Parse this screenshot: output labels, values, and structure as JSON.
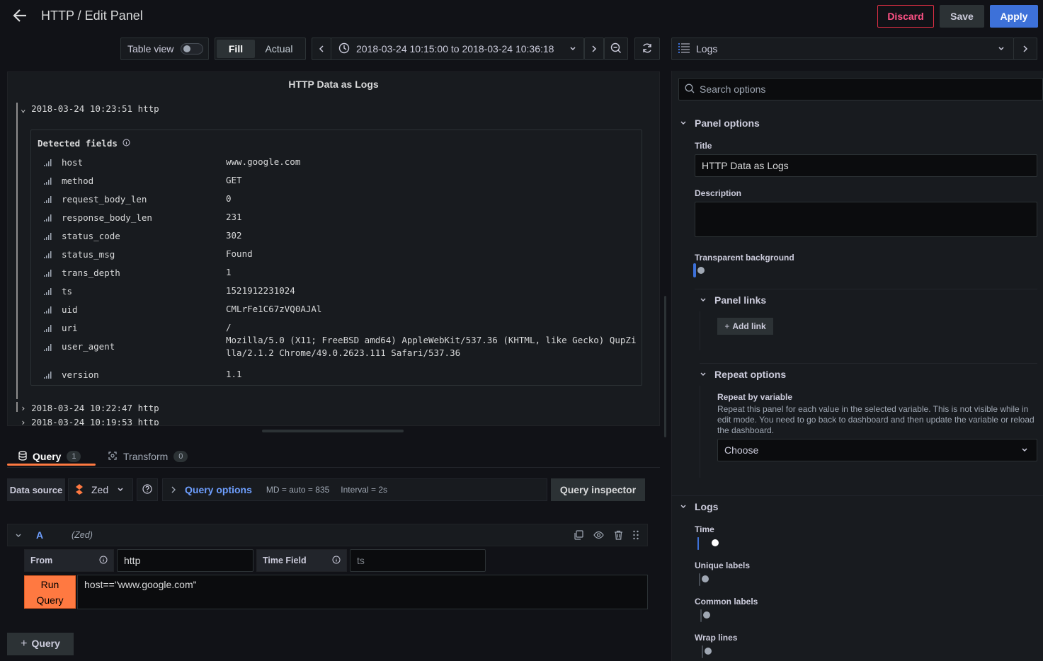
{
  "header": {
    "title": "HTTP / Edit Panel",
    "discard_label": "Discard",
    "save_label": "Save",
    "apply_label": "Apply"
  },
  "toolbar": {
    "table_view_label": "Table view",
    "table_view_on": false,
    "fill_label": "Fill",
    "actual_label": "Actual",
    "time_range": "2018-03-24 10:15:00 to 2018-03-24 10:36:18",
    "visualization": "Logs"
  },
  "panel": {
    "title": "HTTP Data as Logs",
    "log_lines": [
      {
        "caret": "⌄",
        "text": "2018-03-24 10:23:51 http"
      },
      {
        "caret": "›",
        "text": "2018-03-24 10:22:47 http"
      },
      {
        "caret": "›",
        "text": "2018-03-24 10:19:53 http"
      }
    ],
    "detected_fields_label": "Detected fields",
    "fields": [
      {
        "name": "host",
        "value": "www.google.com"
      },
      {
        "name": "method",
        "value": "GET"
      },
      {
        "name": "request_body_len",
        "value": "0"
      },
      {
        "name": "response_body_len",
        "value": "231"
      },
      {
        "name": "status_code",
        "value": "302"
      },
      {
        "name": "status_msg",
        "value": "Found"
      },
      {
        "name": "trans_depth",
        "value": "1"
      },
      {
        "name": "ts",
        "value": "1521912231024"
      },
      {
        "name": "uid",
        "value": "CMLrFe1C67zVQ0AJAl"
      },
      {
        "name": "uri",
        "value": "/"
      },
      {
        "name": "user_agent",
        "value": "Mozilla/5.0 (X11; FreeBSD amd64) AppleWebKit/537.36 (KHTML, like Gecko) QupZilla/2.1.2 Chrome/49.0.2623.111 Safari/537.36"
      },
      {
        "name": "version",
        "value": "1.1"
      }
    ]
  },
  "query_tabs": {
    "query_label": "Query",
    "query_count": "1",
    "transform_label": "Transform",
    "transform_count": "0"
  },
  "datasource": {
    "label": "Data source",
    "name": "Zed",
    "query_options_label": "Query options",
    "md": "MD = auto = 835",
    "interval": "Interval = 2s",
    "inspector_label": "Query inspector"
  },
  "query_a": {
    "ref": "A",
    "ds": "(Zed)",
    "from_label": "From",
    "from_value": "http",
    "time_field_label": "Time Field",
    "time_field_placeholder": "ts",
    "run_line1": "Run",
    "run_line2": "Query",
    "query_text": "host==\"www.google.com\"",
    "add_query_label": "Query"
  },
  "options": {
    "search_placeholder": "Search options",
    "panel_options_label": "Panel options",
    "title_label": "Title",
    "title_value": "HTTP Data as Logs",
    "description_label": "Description",
    "transparent_label": "Transparent background",
    "panel_links_label": "Panel links",
    "add_link_label": "Add link",
    "repeat_options_label": "Repeat options",
    "repeat_by_label": "Repeat by variable",
    "repeat_desc": "Repeat this panel for each value in the selected variable. This is not visible while in edit mode. You need to go back to dashboard and then update the variable or reload the dashboard.",
    "repeat_choose": "Choose",
    "logs_label": "Logs",
    "time_label": "Time",
    "unique_labels_label": "Unique labels",
    "common_labels_label": "Common labels",
    "wrap_lines_label": "Wrap lines"
  },
  "colors": {
    "accent_blue": "#3d71d9",
    "run_orange": "#ff7941",
    "discard_red": "#e02f44"
  }
}
